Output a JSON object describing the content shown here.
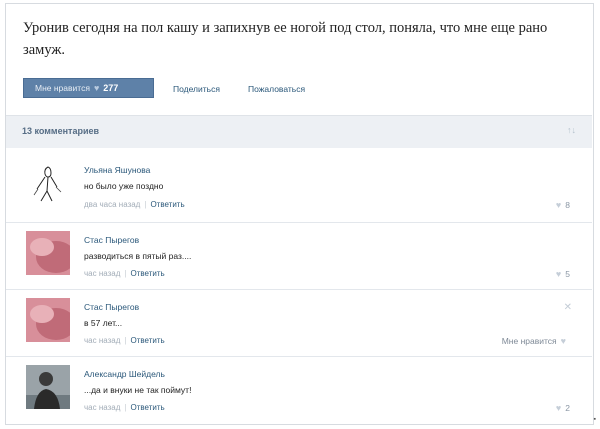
{
  "post": {
    "text": "Уронив сегодня на пол кашу и запихнув ее ногой под стол, поняла, что мне еще рано замуж.",
    "like_label": "Мне нравится",
    "like_count": "277",
    "share_label": "Поделиться",
    "report_label": "Пожаловаться"
  },
  "comments_header": {
    "count_label": "13 комментариев"
  },
  "comments": [
    {
      "author": "Ульяна Яшунова",
      "text": "но было уже поздно",
      "time": "два часа назад",
      "reply_label": "Ответить",
      "likes": "8"
    },
    {
      "author": "Стас Пырегов",
      "text": "разводиться в пятый раз....",
      "time": "час назад",
      "reply_label": "Ответить",
      "likes": "5"
    },
    {
      "author": "Стас Пырегов",
      "text": "в 57 лет...",
      "time": "час назад",
      "reply_label": "Ответить",
      "like_label": "Мне нравится"
    },
    {
      "author": "Александр Шейдель",
      "text": "...да и внуки не так поймут!",
      "time": "час назад",
      "reply_label": "Ответить",
      "likes": "2"
    }
  ],
  "icons": {
    "heart": "heart-icon",
    "sort": "sort-icon",
    "delete": "close-icon"
  },
  "colors": {
    "accent": "#5e81a8",
    "link": "#2b587a",
    "meta": "#a3adb8",
    "bar": "#edf0f4"
  }
}
